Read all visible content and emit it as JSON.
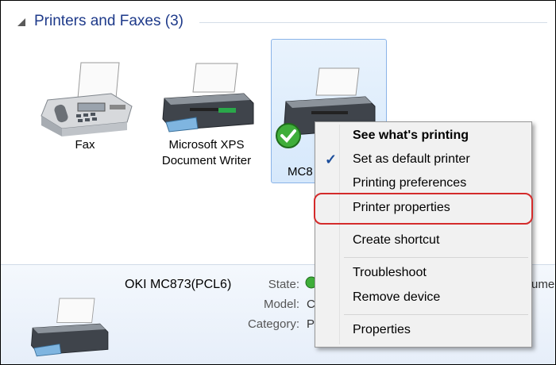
{
  "group": {
    "title": "Printers and Faxes (3)"
  },
  "devices": [
    {
      "label": "Fax",
      "icon": "fax-icon"
    },
    {
      "label": "Microsoft XPS Document Writer",
      "line1": "Microsoft XPS",
      "line2": "Document Writer",
      "icon": "printer-icon"
    },
    {
      "label": "MC8",
      "icon": "printer-icon",
      "badge": "default-check-icon"
    }
  ],
  "details": {
    "name": "OKI MC873(PCL6)",
    "state_key": "State:",
    "state_val": "",
    "model_key": "Model:",
    "model_val": "C",
    "category_key": "Category:",
    "category_val": "P",
    "right_fragment": "ume"
  },
  "context_menu": {
    "items": [
      {
        "label": "See what's printing",
        "bold": true
      },
      {
        "label": "Set as default printer",
        "checked": true
      },
      {
        "label": "Printing preferences"
      },
      {
        "label": "Printer properties",
        "highlighted": true
      },
      {
        "label": "Create shortcut"
      },
      {
        "label": "Troubleshoot"
      },
      {
        "label": "Remove device"
      },
      {
        "label": "Properties"
      }
    ]
  },
  "colors": {
    "header_text": "#1e3a8a",
    "selection_bg": "#d6e8fb",
    "highlight_ring": "#d42b2b",
    "check": "#1b4d9b"
  }
}
